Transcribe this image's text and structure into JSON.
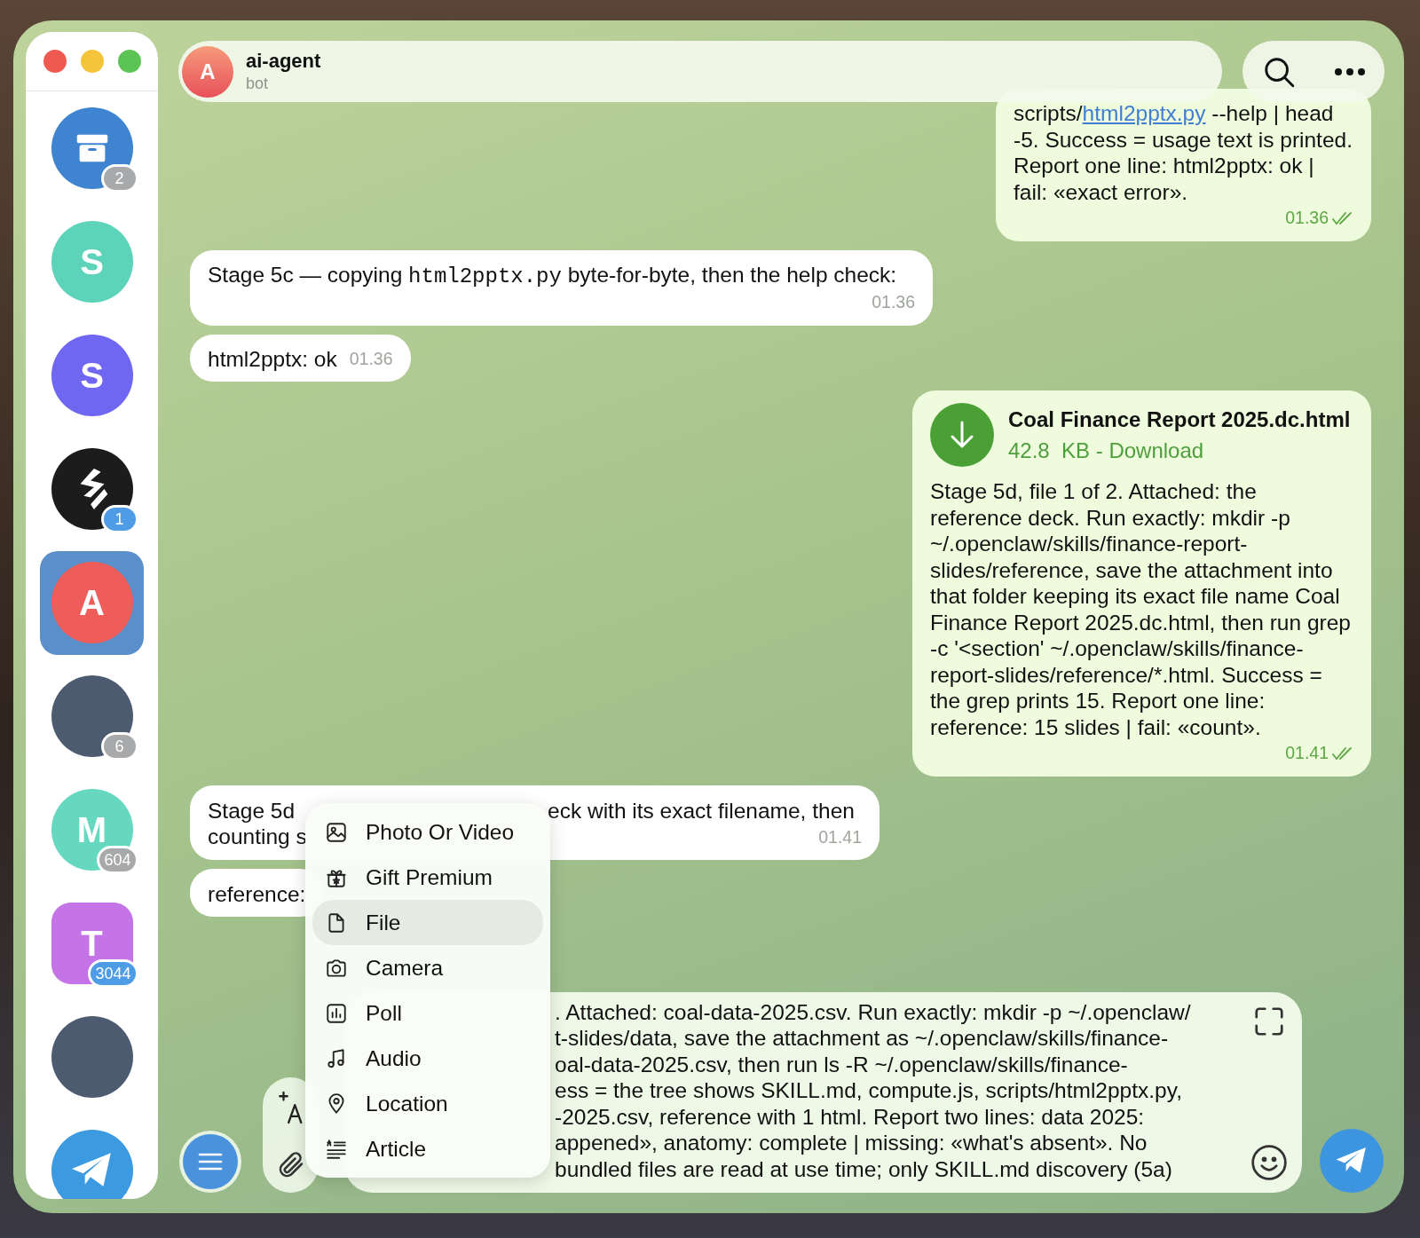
{
  "sidebar": {
    "chats": [
      {
        "kind": "archive",
        "badge": "2",
        "muted": true,
        "selected": false
      },
      {
        "kind": "letter",
        "letter": "S",
        "color": "#5dd3b9",
        "selected": false
      },
      {
        "kind": "letter",
        "letter": "S",
        "color": "#6f66f2",
        "selected": false
      },
      {
        "kind": "logo",
        "badge": "1",
        "muted": false,
        "selected": false
      },
      {
        "kind": "letter",
        "letter": "A",
        "color": "#ee5d5a",
        "selected": true
      },
      {
        "kind": "photo",
        "badge": "6",
        "muted": true,
        "selected": false
      },
      {
        "kind": "letter",
        "letter": "M",
        "color": "#66d8bf",
        "badge": "604",
        "muted": true,
        "selected": false
      },
      {
        "kind": "forum",
        "letter": "T",
        "color": "#c474e6",
        "badge": "3044",
        "muted": false,
        "selected": false
      },
      {
        "kind": "photo",
        "selected": false
      },
      {
        "kind": "app",
        "selected": false
      }
    ]
  },
  "header": {
    "avatar_letter": "A",
    "title": "ai-agent",
    "subtitle": "bot"
  },
  "messages": [
    {
      "kind": "text",
      "outgoing": true,
      "parts": [
        {
          "text": "scripts/"
        },
        {
          "text": "html2pptx.py",
          "kind": "link"
        },
        {
          "text": " --help | head -5. Success = usage text is printed. Report one line: html2pptx: ok | fail: «exact error»."
        }
      ],
      "time": "01.36",
      "read": true
    },
    {
      "kind": "text",
      "outgoing": false,
      "parts": [
        {
          "text": "Stage 5c — copying "
        },
        {
          "text": "html2pptx.py",
          "kind": "code"
        },
        {
          "text": " byte-for-byte, then the help check:"
        }
      ],
      "time": "01.36"
    },
    {
      "kind": "text",
      "outgoing": false,
      "parts": [
        {
          "text": "html2pptx: ok"
        }
      ],
      "time": "01.36"
    },
    {
      "kind": "file",
      "outgoing": true,
      "file": {
        "name": "Coal Finance Report 2025.dc.html",
        "size": "42.8  KB - Download"
      },
      "parts": [
        {
          "text": "Stage 5d, file 1 of 2. Attached: the reference deck. Run exactly: mkdir -p ~/.openclaw/skills/finance-report-slides/reference, save the attachment into that folder keeping its exact file name Coal Finance Report 2025.dc.html, then run grep -c '<section' ~/.openclaw/skills/finance-report-slides/reference/*.html. Success = the grep prints 15. Report one line: reference: 15 slides | fail: «count»."
        }
      ],
      "time": "01.41",
      "read": true
    },
    {
      "kind": "covered",
      "outgoing": false,
      "left_lines": [
        "Stage 5d",
        "counting s"
      ],
      "right_lines": [
        "eck with its exact filename, then"
      ],
      "time": "01.41"
    },
    {
      "kind": "covered",
      "outgoing": false,
      "left_lines": [
        "reference:"
      ]
    }
  ],
  "attach_menu": {
    "items": [
      {
        "label": "Photo Or Video",
        "selected": false
      },
      {
        "label": "Gift Premium",
        "selected": false
      },
      {
        "label": "File",
        "selected": true
      },
      {
        "label": "Camera",
        "selected": false
      },
      {
        "label": "Poll",
        "selected": false
      },
      {
        "label": "Audio",
        "selected": false
      },
      {
        "label": "Location",
        "selected": false
      },
      {
        "label": "Article",
        "selected": false
      }
    ]
  },
  "composer": {
    "value_lines": [
      ". Attached: coal-data-2025.csv. Run exactly: mkdir -p ~/.openclaw/",
      "t-slides/data, save the attachment as ~/.openclaw/skills/finance-",
      "oal-data-2025.csv, then run ls -R ~/.openclaw/skills/finance-",
      "ess = the tree shows SKILL.md, compute.js, scripts/html2pptx.py,",
      "-2025.csv, reference with 1 html. Report two lines: data 2025:",
      "appened», anatomy: complete | missing: «what's absent». No",
      "bundled files are read at use time; only SKILL.md discovery (5a)"
    ]
  }
}
